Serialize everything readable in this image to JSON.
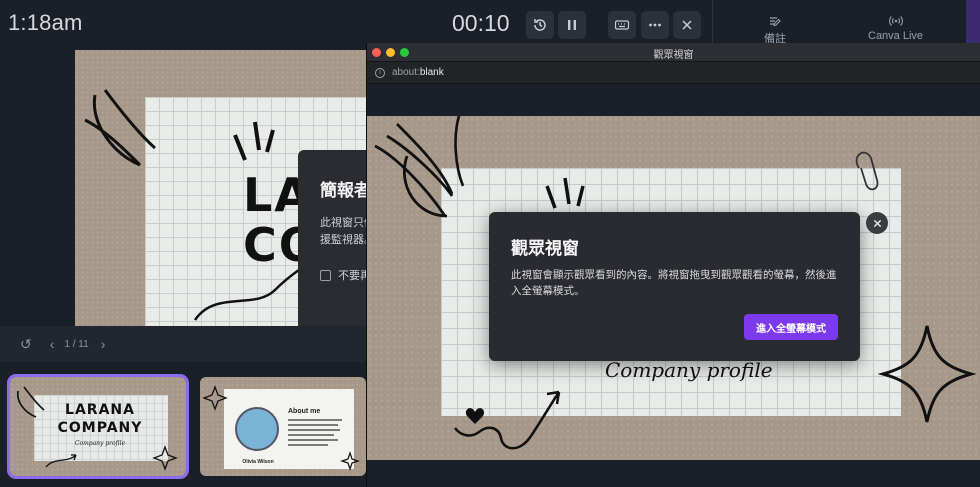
{
  "presenter": {
    "clock": "1:18am",
    "timer": "00:10",
    "right_panel": {
      "notes_label": "備註",
      "canva_live_label": "Canva Live"
    },
    "main_slide": {
      "letters_line1": "LA",
      "letters_line2": "CO"
    },
    "background_dialog": {
      "title": "簡報者",
      "desc_line1": "此視窗只供",
      "desc_line2": "援監視器。",
      "checkbox_label": "不要再"
    },
    "pagination": {
      "page": "1 / 11"
    },
    "thumbnails": [
      {
        "title_line1": "LARANA",
        "title_line2": "COMPANY",
        "subtitle": "Company profile"
      },
      {
        "heading": "About me",
        "name": "Olivia Wilson"
      }
    ]
  },
  "popup": {
    "window_title": "觀眾視窗",
    "address": {
      "scheme": "about:",
      "host": "blank"
    },
    "slide_script": "Company profile",
    "dialog": {
      "title": "觀眾視窗",
      "body": "此視窗會顯示觀眾看到的內容。將視窗拖曳到觀眾觀看的螢幕，然後進入全螢幕模式。",
      "button": "進入全螢幕模式"
    }
  },
  "colors": {
    "accent": "#7c3aed",
    "selected_outline": "#8b6cf0",
    "traffic_red": "#ff5f57",
    "traffic_yellow": "#febc2e",
    "traffic_green": "#28c840"
  }
}
